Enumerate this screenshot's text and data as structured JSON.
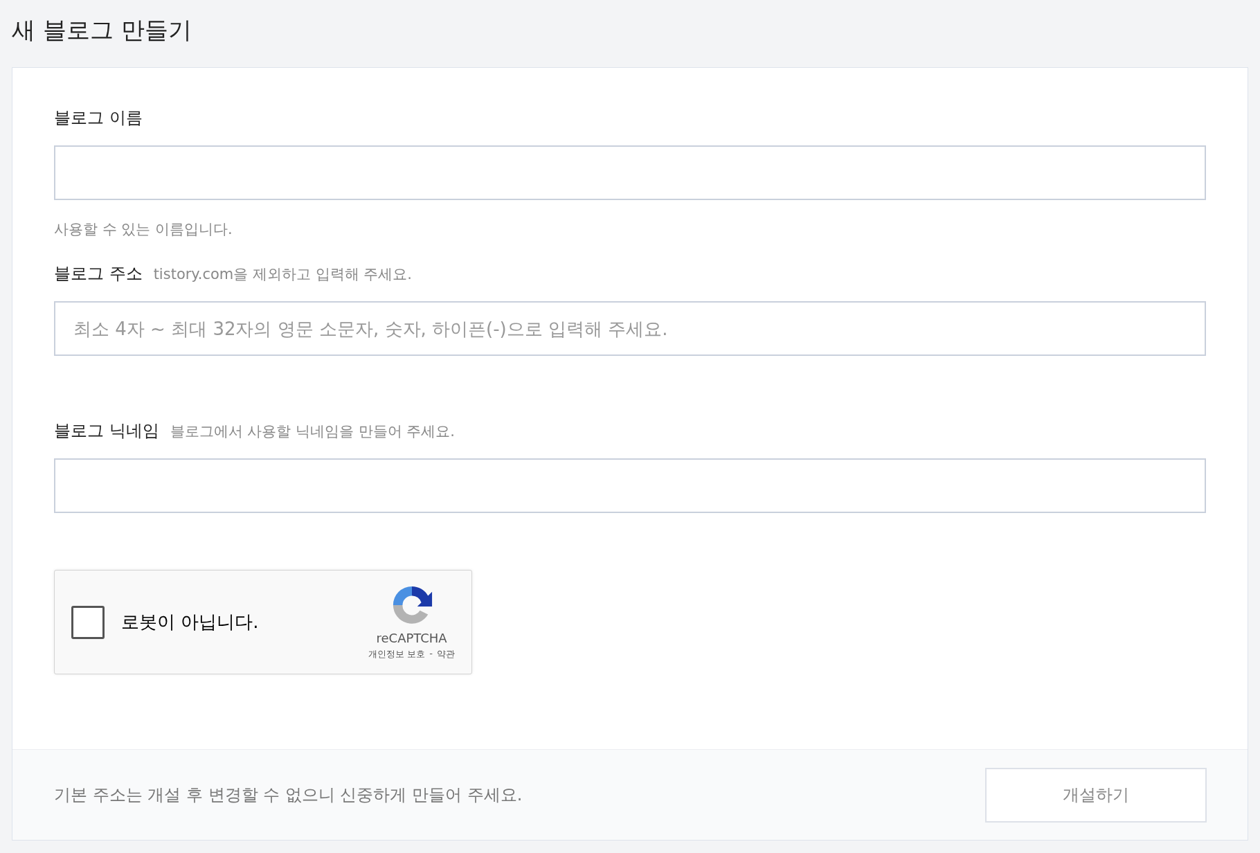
{
  "page": {
    "title": "새 블로그 만들기"
  },
  "fields": [
    {
      "label": "블로그 이름",
      "message": "사용할 수 있는 이름입니다."
    },
    {
      "label": "블로그 주소",
      "help": "tistory.com을 제외하고 입력해 주세요.",
      "placeholder": "최소 4자 ~ 최대 32자의 영문 소문자, 숫자, 하이픈(-)으로 입력해 주세요."
    },
    {
      "label": "블로그 닉네임",
      "help": "블로그에서 사용할 닉네임을 만들어 주세요."
    }
  ],
  "captcha": {
    "checked": false,
    "label": "로봇이 아닙니다.",
    "brand": "reCAPTCHA",
    "privacy": "개인정보 보호",
    "separator": "-",
    "terms": "약관"
  },
  "footer": {
    "notice": "기본 주소는 개설 후 변경할 수 없으니 신중하게 만들어 주세요.",
    "button": "개설하기"
  }
}
